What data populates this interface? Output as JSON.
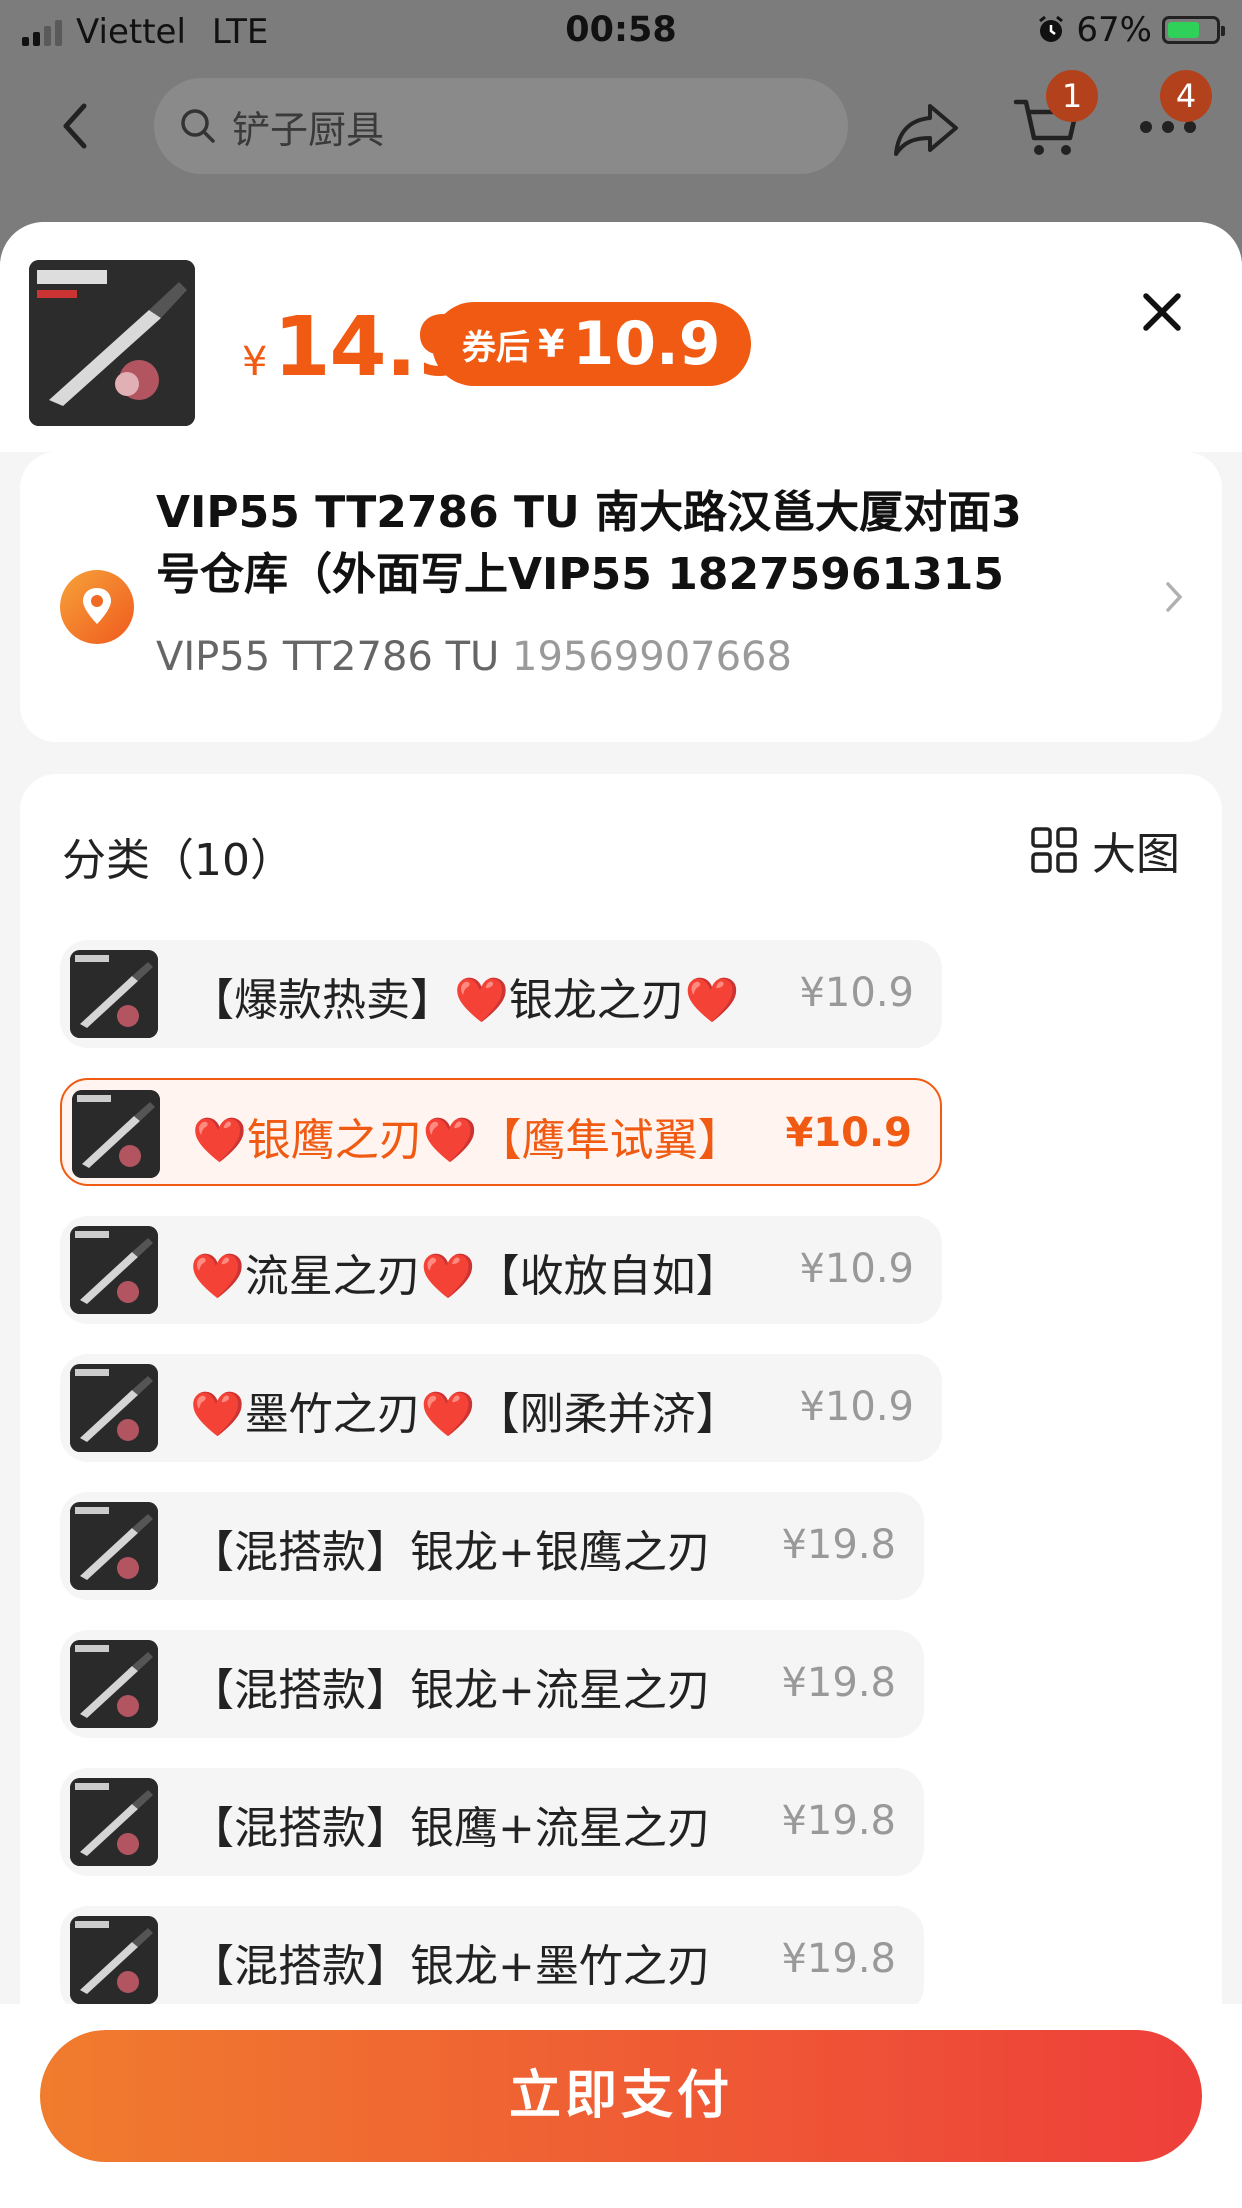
{
  "status_bar": {
    "carrier": "Viettel",
    "network": "LTE",
    "time": "00:58",
    "battery": "67%"
  },
  "nav": {
    "search_placeholder": "铲子厨具",
    "cart_badge": "1",
    "more_badge": "4"
  },
  "product": {
    "price_currency": "¥",
    "price": "14.9",
    "coupon_label": "券后",
    "coupon_currency": "¥",
    "coupon_price": "10.9"
  },
  "address": {
    "line1": "VIP55 TT2786 TU 南大路汉邕大厦对面3",
    "line2": "号仓库（外面写上VIP55 18275961315",
    "name": "VIP55 TT2786 TU",
    "phone": "19569907668"
  },
  "sku": {
    "title": "分类（10）",
    "big_image_label": "大图",
    "options": [
      {
        "pre": "【爆款热卖】",
        "heart1": "❤️",
        "mid": "银龙之刃",
        "heart2": "❤️",
        "post": "",
        "price": "¥10.9",
        "selected": false
      },
      {
        "pre": "",
        "heart1": "❤️",
        "mid": "银鹰之刃",
        "heart2": "❤️",
        "post": "【鹰隼试翼】",
        "price": "¥10.9",
        "selected": true
      },
      {
        "pre": "",
        "heart1": "❤️",
        "mid": "流星之刃",
        "heart2": "❤️",
        "post": "【收放自如】",
        "price": "¥10.9",
        "selected": false
      },
      {
        "pre": "",
        "heart1": "❤️",
        "mid": "墨竹之刃",
        "heart2": "❤️",
        "post": "【刚柔并济】",
        "price": "¥10.9",
        "selected": false
      },
      {
        "pre": "【混搭款】银龙+银鹰之刃",
        "heart1": "",
        "mid": "",
        "heart2": "",
        "post": "",
        "price": "¥19.8",
        "selected": false
      },
      {
        "pre": "【混搭款】银龙+流星之刃",
        "heart1": "",
        "mid": "",
        "heart2": "",
        "post": "",
        "price": "¥19.8",
        "selected": false
      },
      {
        "pre": "【混搭款】银鹰+流星之刃",
        "heart1": "",
        "mid": "",
        "heart2": "",
        "post": "",
        "price": "¥19.8",
        "selected": false
      },
      {
        "pre": "【混搭款】银龙+墨竹之刃",
        "heart1": "",
        "mid": "",
        "heart2": "",
        "post": "",
        "price": "¥19.8",
        "selected": false
      }
    ]
  },
  "footer": {
    "pay_label": "立即支付"
  },
  "colors": {
    "accent": "#f05a12",
    "pay_gradient_start": "#f07c2e",
    "pay_gradient_end": "#ee3f3a"
  }
}
